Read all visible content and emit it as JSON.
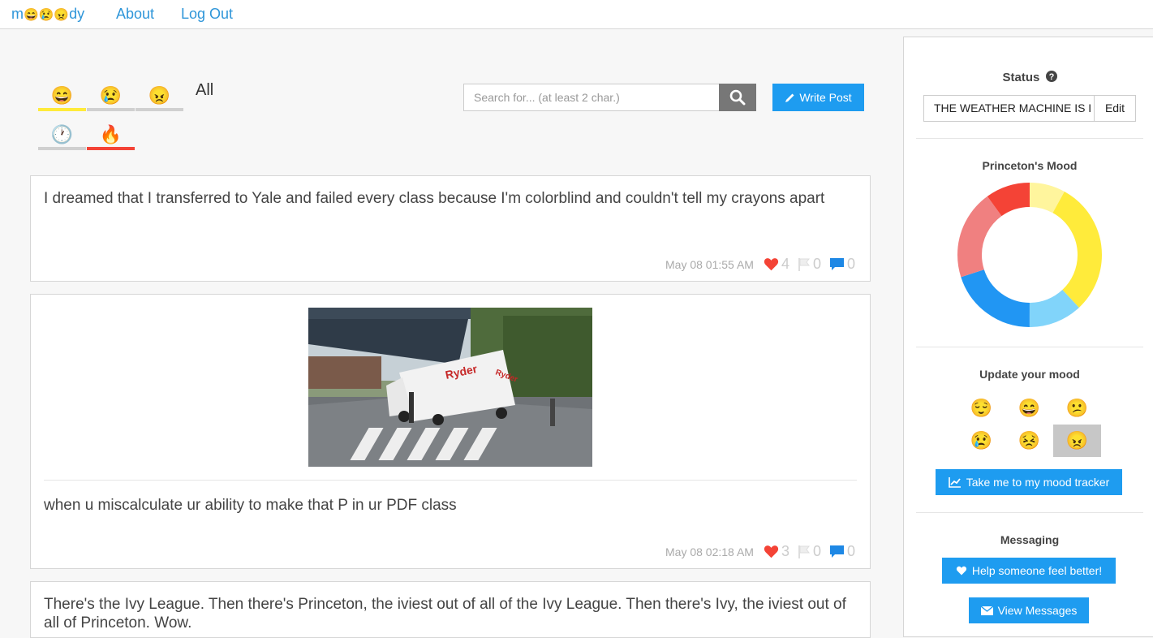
{
  "nav": {
    "brand_m": "m",
    "brand_emojis": [
      "😄",
      "😢",
      "😠"
    ],
    "brand_dy": "dy",
    "about": "About",
    "logout": "Log Out"
  },
  "filters": {
    "moods": [
      {
        "emoji": "😄",
        "bar_color": "#ffeb3b"
      },
      {
        "emoji": "😢",
        "bar_color": "#d0d0d0"
      },
      {
        "emoji": "😠",
        "bar_color": "#d0d0d0"
      }
    ],
    "all_label": "All",
    "sort": [
      {
        "emoji": "🕐",
        "bar_color": "#d0d0d0"
      },
      {
        "emoji": "🔥",
        "bar_color": "#f44336"
      }
    ]
  },
  "search": {
    "placeholder": "Search for... (at least 2 char.)"
  },
  "write_post": "Write Post",
  "posts": [
    {
      "text": "I dreamed that I transferred to Yale and failed every class because I'm colorblind and couldn't tell my crayons apart",
      "time": "May 08 01:55 AM",
      "hearts": "4",
      "flags": "0",
      "comments": "0"
    },
    {
      "text": "when u miscalculate ur ability to make that P in ur PDF class",
      "time": "May 08 02:18 AM",
      "hearts": "3",
      "flags": "0",
      "comments": "0"
    },
    {
      "text": "There's the Ivy League. Then there's Princeton, the iviest out of all of the Ivy League. Then there's Ivy, the iviest out of all of Princeton. Wow."
    }
  ],
  "sidebar": {
    "status_title": "Status",
    "status_value": "THE WEATHER MACHINE IS I",
    "edit": "Edit",
    "mood_title": "Princeton's Mood",
    "mood_chart": {
      "type": "pie",
      "colors": [
        "#fff59d",
        "#ffeb3b",
        "#81d4fa",
        "#2196f3",
        "#f08080",
        "#f44336"
      ],
      "values": [
        0.08,
        0.3,
        0.12,
        0.2,
        0.2,
        0.1
      ]
    },
    "update_title": "Update your mood",
    "moods": [
      "😌",
      "😄",
      "😕",
      "😢",
      "😣",
      "😠"
    ],
    "selected_mood": "😠",
    "tracker": "Take me to my mood tracker",
    "messaging_title": "Messaging",
    "help": "Help someone feel better!",
    "view_messages": "View Messages"
  }
}
